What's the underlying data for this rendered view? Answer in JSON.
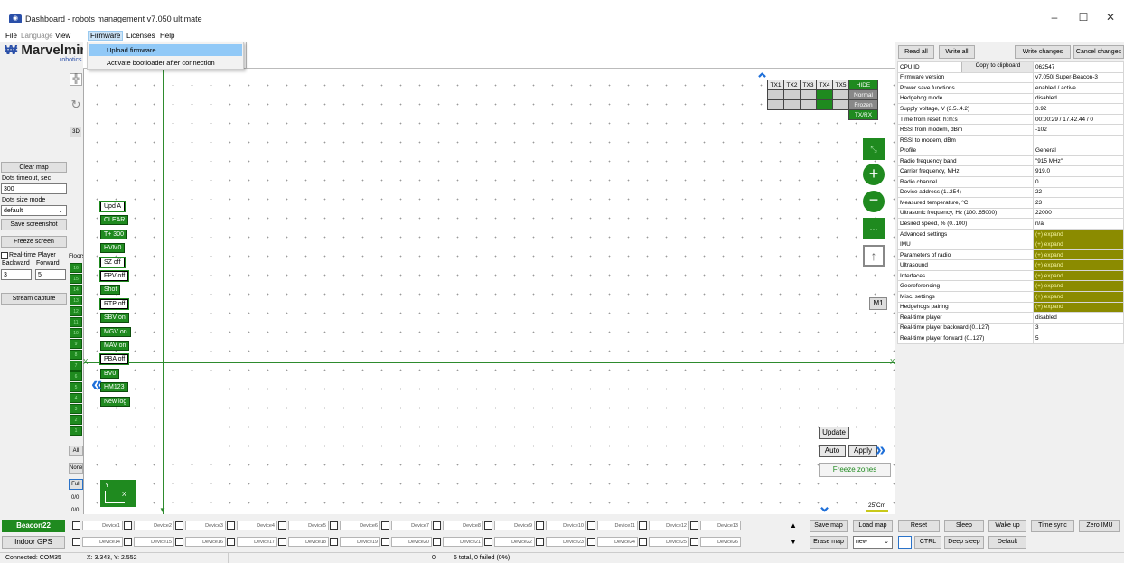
{
  "window": {
    "title": "Dashboard - robots management  v7.050  ultimate",
    "minimize": "–",
    "maximize": "☐",
    "close": "✕"
  },
  "menu": {
    "file": "File",
    "language": "Language",
    "view": "View",
    "firmware": "Firmware",
    "licenses": "Licenses",
    "help": "Help"
  },
  "firmware_menu": {
    "upload": "Upload firmware",
    "bootloader": "Activate bootloader after connection"
  },
  "logo": {
    "name": "Marvelmind",
    "sub": "robotics"
  },
  "left_panel": {
    "clear_map": "Clear map",
    "dots_timeout_label": "Dots timeout, sec",
    "dots_timeout_value": "300",
    "dots_size_label": "Dots size mode",
    "dots_size_value": "default",
    "save_screenshot": "Save screenshot",
    "freeze_screen": "Freeze screen",
    "realtime_player": "Real-time Player",
    "backward": "Backward",
    "forward": "Forward",
    "backward_value": "3",
    "forward_value": "5",
    "floors": "Floors",
    "stream_capture": "Stream capture"
  },
  "tools": {
    "mode_3d": "3D",
    "all": "All",
    "none": "None",
    "full": "Full",
    "counter1": "0/0",
    "counter2": "0/0"
  },
  "floors": [
    "16",
    "15",
    "14",
    "13",
    "12",
    "11",
    "10",
    "9",
    "8",
    "7",
    "6",
    "5",
    "4",
    "3",
    "2",
    "1"
  ],
  "map_buttons": [
    {
      "label": "Upd A",
      "style": "white"
    },
    {
      "label": "CLEAR",
      "style": "green"
    },
    {
      "label": "T+ 300",
      "style": "green"
    },
    {
      "label": "HVM0",
      "style": "green"
    },
    {
      "label": "SZ off",
      "style": "white"
    },
    {
      "label": "FPV off",
      "style": "white"
    },
    {
      "label": "Shot",
      "style": "green"
    },
    {
      "label": "RTP off",
      "style": "white"
    },
    {
      "label": "SBV on",
      "style": "green"
    },
    {
      "label": "MGV on",
      "style": "green"
    },
    {
      "label": "MAV on",
      "style": "green"
    },
    {
      "label": "PBA off",
      "style": "white"
    },
    {
      "label": "BV0",
      "style": "green"
    },
    {
      "label": "HM123",
      "style": "green"
    },
    {
      "label": "New log",
      "style": "green"
    }
  ],
  "tx_panel": {
    "headers": [
      "TX1",
      "TX2",
      "TX3",
      "TX4",
      "TX5"
    ],
    "hide": "HIDE",
    "normal": "Normal",
    "frozen": "Frozen",
    "txrx": "TX/RX"
  },
  "map_controls": {
    "m1": "M1",
    "update": "Update",
    "auto": "Auto",
    "apply": "Apply",
    "freeze_zones": "Freeze zones",
    "scale": "25 Cm",
    "axis_y": "Y",
    "axis_x": "X",
    "axis_label_x": "X",
    "axis_label_y": "Y"
  },
  "right_panel": {
    "read_all": "Read all",
    "write_all": "Write all",
    "write_changes": "Write changes",
    "cancel_changes": "Cancel changes",
    "copy_clipboard": "Copy to clipboard",
    "rows": [
      {
        "key": "CPU ID",
        "value": "062547"
      },
      {
        "key": "Firmware version",
        "value": "v7.050i Super-Beacon-3"
      },
      {
        "key": "Power save functions",
        "value": "enabled / active"
      },
      {
        "key": "Hedgehog mode",
        "value": "disabled"
      },
      {
        "key": "Supply voltage, V (3.5..4.2)",
        "value": "3.92"
      },
      {
        "key": "Time from reset, h:m:s",
        "value": "00:00:29 / 17.42.44 / 0"
      },
      {
        "key": "RSSI from modem, dBm",
        "value": "-102"
      },
      {
        "key": "RSSI to modem, dBm",
        "value": ""
      },
      {
        "key": "Profile",
        "value": "General"
      },
      {
        "key": "Radio frequency band",
        "value": "\"915 MHz\""
      },
      {
        "key": "Carrier frequency, MHz",
        "value": "919.0"
      },
      {
        "key": "Radio channel",
        "value": "0"
      },
      {
        "key": "Device address (1..254)",
        "value": "22"
      },
      {
        "key": "Measured temperature, °C",
        "value": "23"
      },
      {
        "key": "Ultrasonic frequency, Hz (100..65000)",
        "value": "22000"
      },
      {
        "key": "Desired speed, % (0..100)",
        "value": "n/a"
      },
      {
        "key": "Advanced settings",
        "value": "(+) expand",
        "olive": true
      },
      {
        "key": "IMU",
        "value": "(+) expand",
        "olive": true
      },
      {
        "key": "Parameters of radio",
        "value": "(+) expand",
        "olive": true
      },
      {
        "key": "Ultrasound",
        "value": "(+) expand",
        "olive": true
      },
      {
        "key": "Interfaces",
        "value": "(+) expand",
        "olive": true
      },
      {
        "key": "Georeferencing",
        "value": "(+) expand",
        "olive": true
      },
      {
        "key": "Misc. settings",
        "value": "(+) expand",
        "olive": true
      },
      {
        "key": "Hedgehogs pairing",
        "value": "(+) expand",
        "olive": true
      },
      {
        "key": "Real-time player",
        "value": "disabled"
      },
      {
        "key": "Real-time player backward (0..127)",
        "value": "3"
      },
      {
        "key": "Real-time player forward (0..127)",
        "value": "5"
      }
    ]
  },
  "bottom": {
    "beacon": "Beacon22",
    "indoor_gps": "Indoor GPS",
    "devices_row1": [
      "Device1",
      "Device2",
      "Device3",
      "Device4",
      "Device5",
      "Device6",
      "Device7",
      "Device8",
      "Device9",
      "Device10",
      "Device11",
      "Device12",
      "Device13"
    ],
    "devices_row2": [
      "Device14",
      "Device15",
      "Device16",
      "Device17",
      "Device18",
      "Device19",
      "Device20",
      "Device21",
      "Device22",
      "Device23",
      "Device24",
      "Device25",
      "Device26"
    ],
    "save_map": "Save map",
    "load_map": "Load map",
    "erase_map": "Erase map",
    "map_select": "new",
    "reset": "Reset",
    "sleep": "Sleep",
    "wake_up": "Wake up",
    "time_sync": "Time sync",
    "zero_imu": "Zero IMU",
    "ctrl": "CTRL",
    "deep_sleep": "Deep sleep",
    "default": "Default"
  },
  "status": {
    "connection": "Connected: COM35",
    "coords": "X: 3.343, Y: 2.552",
    "zero": "0",
    "summary": "6 total, 0 failed (0%)"
  },
  "colors": {
    "accent_green": "#1f8a1f",
    "olive": "#8b8b00",
    "blue_arrow": "#1e6fd9"
  }
}
